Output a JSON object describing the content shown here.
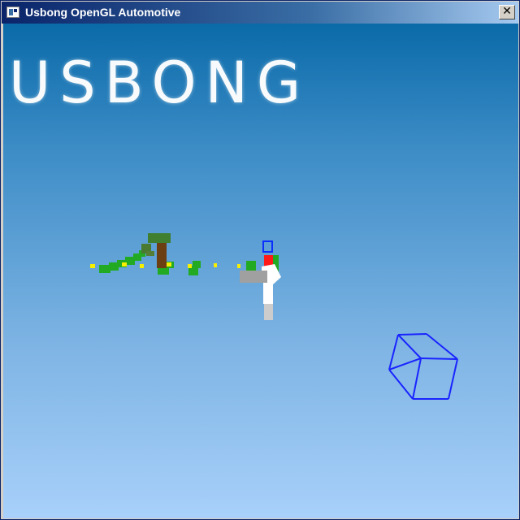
{
  "window": {
    "title": "Usbong OpenGL Automotive",
    "close_label": "✕"
  },
  "scene": {
    "logo_text": "USBONG"
  },
  "colors": {
    "sky_top": "#0a6aa8",
    "sky_bottom": "#a8d0fa",
    "road_marker": "#f6f000",
    "grass": "#22aa22",
    "tree_trunk": "#6b3f12",
    "tree_leaves": "#3f7f2f",
    "car_body": "#ffffff",
    "car_gray": "#a0a0a0",
    "car_red": "#ff1a1a",
    "car_blue_outline": "#0b2fff",
    "cube_wire": "#1a24ff"
  }
}
